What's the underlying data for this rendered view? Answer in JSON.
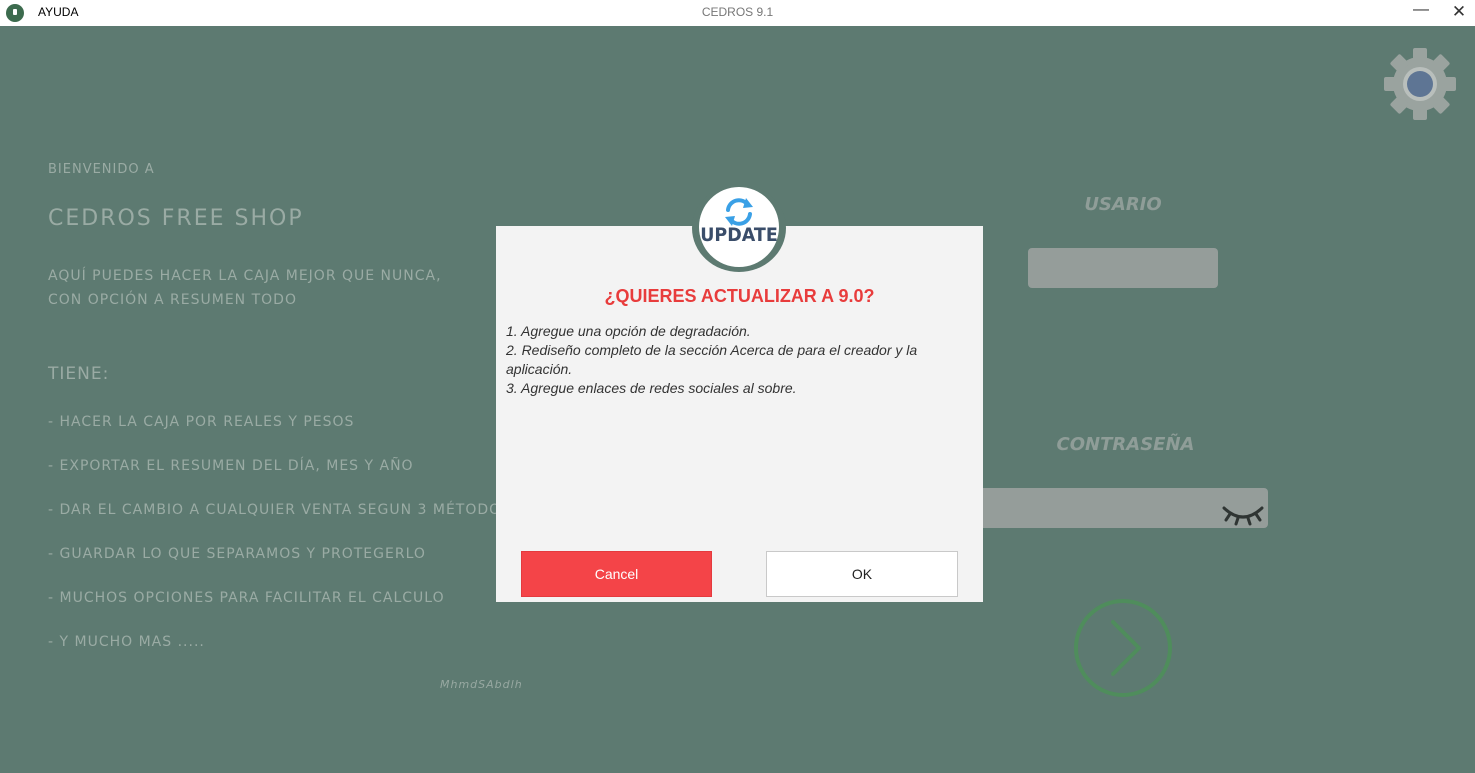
{
  "titlebar": {
    "menu_label": "AYUDA",
    "window_title": "CEDROS 9.1",
    "minimize_glyph": "—",
    "close_glyph": "✕"
  },
  "welcome": {
    "greeting": "BIENVENIDO A",
    "brand": "CEDROS FREE SHOP",
    "intro_lines": [
      "AQUÍ PUEDES HACER LA CAJA MEJOR QUE NUNCA,",
      "CON OPCIÓN A RESUMEN TODO"
    ],
    "features_title": "TIENE:",
    "features": [
      "- HACER LA CAJA POR REALES Y PESOS",
      "- EXPORTAR EL RESUMEN DEL DÍA, MES Y AÑO",
      "- DAR EL CAMBIO A CUALQUIER VENTA SEGUN 3 MÉTODOS",
      "- GUARDAR LO QUE SEPARAMOS Y PROTEGERLO",
      "- MUCHOS OPCIONES PARA FACILITAR EL CALCULO",
      "- Y MUCHO MAS ....."
    ],
    "author": "MhmdSAbdlh"
  },
  "login": {
    "user_label": "USARIO",
    "password_label": "CONTRASEÑA",
    "user_value": "",
    "password_value": ""
  },
  "icons": {
    "settings": "gear-icon",
    "password_toggle": "eye-closed-icon",
    "submit": "chevron-right-icon",
    "update": "sync-icon"
  },
  "dialog": {
    "badge_text": "UPDATE",
    "title": "¿QUIERES ACTUALIZAR A 9.0?",
    "changes": [
      "1. Agregue una opción de degradación.",
      "2. Rediseño completo de la sección Acerca de para el creador y la aplicación.",
      "3. Agregue enlaces de redes sociales al sobre."
    ],
    "cancel_label": "Cancel",
    "ok_label": "OK"
  },
  "colors": {
    "background": "#5d7a71",
    "accent_red": "#f44448",
    "title_red": "#e83c3c",
    "submit_green": "#3a9a4a"
  }
}
